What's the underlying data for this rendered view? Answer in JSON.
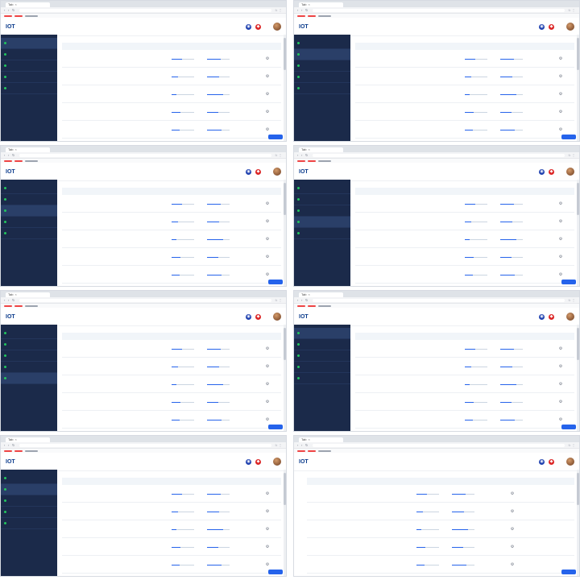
{
  "app": {
    "tab_label": "Tab",
    "logo": "IOT",
    "logo_sub": "",
    "header_links": [
      "",
      ""
    ],
    "crumb": ""
  },
  "columns": [
    "",
    "",
    "",
    "",
    ""
  ],
  "sidebar_items": [
    {
      "label": "",
      "sub": ""
    },
    {
      "label": "",
      "sub": ""
    },
    {
      "label": "",
      "sub": ""
    },
    {
      "label": "",
      "sub": ""
    },
    {
      "label": "",
      "sub": ""
    }
  ],
  "rows": [
    {
      "name": "",
      "status": "",
      "m1": "",
      "m1_level": 0.45,
      "m2": "",
      "m2_level": 0.6,
      "m3": ""
    },
    {
      "name": "",
      "status": "",
      "m1": "",
      "m1_level": 0.3,
      "m2": "",
      "m2_level": 0.55,
      "m3": ""
    },
    {
      "name": "",
      "status": "",
      "m1": "",
      "m1_level": 0.2,
      "m2": "",
      "m2_level": 0.7,
      "m3": ""
    },
    {
      "name": "",
      "status": "",
      "m1": "",
      "m1_level": 0.4,
      "m2": "",
      "m2_level": 0.5,
      "m3": ""
    },
    {
      "name": "",
      "status": "",
      "m1": "",
      "m1_level": 0.35,
      "m2": "",
      "m2_level": 0.65,
      "m3": ""
    }
  ],
  "fab_label": "",
  "colors": {
    "accent": "#2563eb",
    "sidebar": "#1b2a4a",
    "brand": "#0b3b8c",
    "alert": "#dc2626"
  },
  "icons": {
    "row_action": "settings-gear-icon",
    "header_1": "globe-icon",
    "header_2": "shield-icon"
  }
}
